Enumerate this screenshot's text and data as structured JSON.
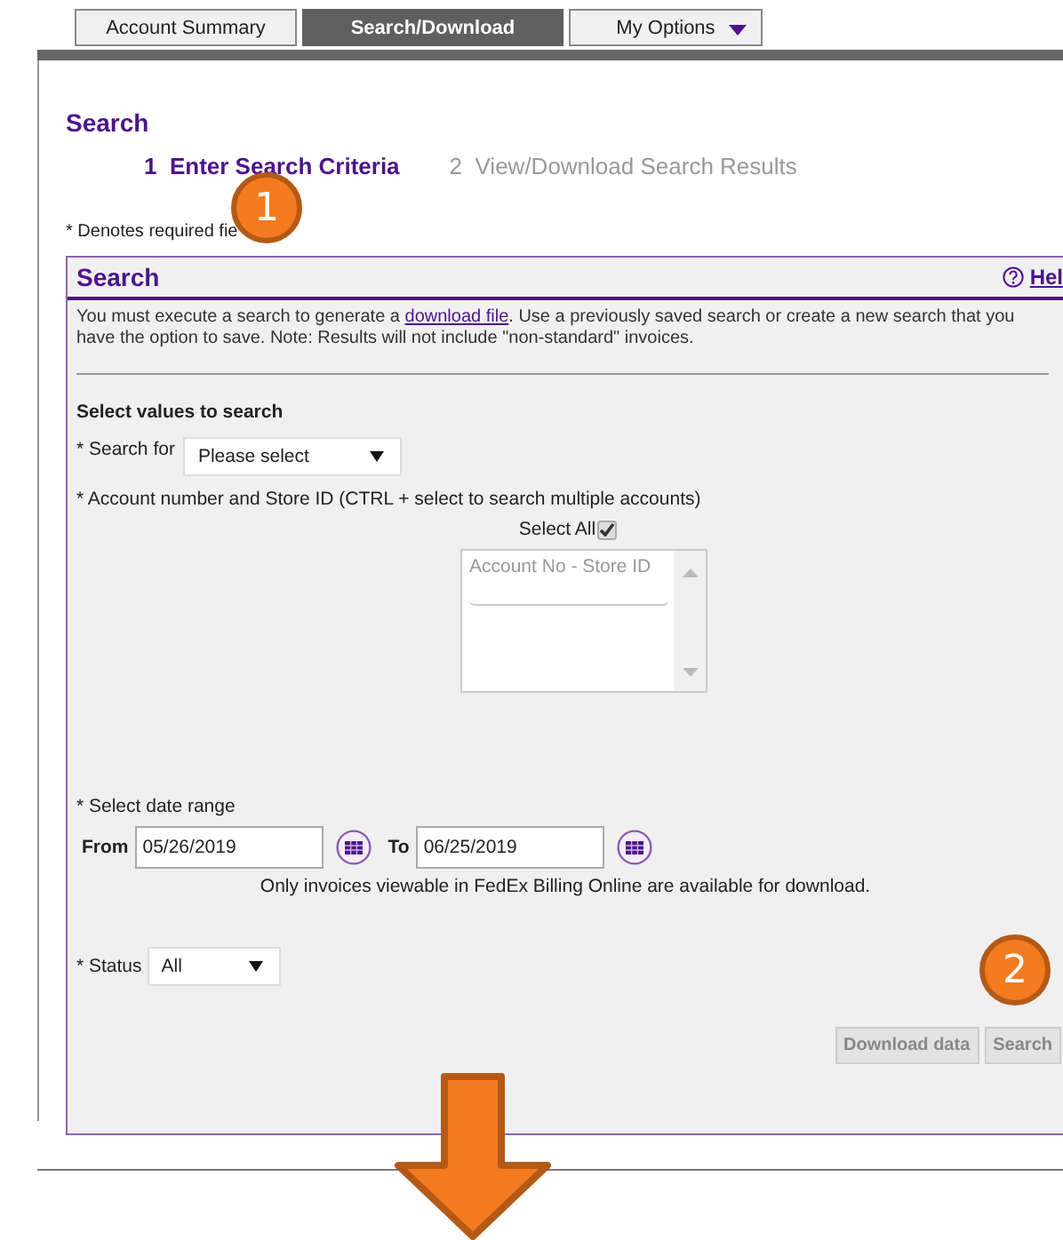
{
  "tabs": [
    {
      "label": "Account Summary",
      "selected": false,
      "dropdown": false
    },
    {
      "label": "Search/Download",
      "selected": true,
      "dropdown": false
    },
    {
      "label": "My Options",
      "selected": false,
      "dropdown": true
    }
  ],
  "page_title": "Search",
  "steps": [
    {
      "number": "1",
      "label": "Enter Search Criteria",
      "selected": true
    },
    {
      "number": "2",
      "label": "View/Download Search Results",
      "selected": false
    }
  ],
  "required_note": "* Denotes required fie",
  "panel": {
    "title": "Search",
    "help": "Hel",
    "intro": {
      "before": "You must execute a search to generate a ",
      "link": "download file",
      "after": ". Use a previously saved search or create a new search that you have the option to save. Note: Results will not include \"non-standard\" invoices."
    },
    "section_title": "Select values to search",
    "search_for": {
      "label": "* Search for",
      "value": "Please select"
    },
    "account_label": "* Account number and Store ID (CTRL + select to search multiple accounts)",
    "select_all": {
      "label": "Select All",
      "checked": true
    },
    "account_list": {
      "header": "Account No - Store ID"
    },
    "date_label": "* Select date range",
    "from": {
      "label": "From",
      "value": "05/26/2019"
    },
    "to": {
      "label": "To",
      "value": "06/25/2019"
    },
    "date_note": "Only invoices viewable in FedEx Billing Online are available for download.",
    "status": {
      "label": "* Status",
      "value": "All"
    },
    "buttons": [
      {
        "label": "Download data",
        "disabled": true
      },
      {
        "label": "Search",
        "disabled": true
      }
    ]
  },
  "callouts": [
    "1",
    "2"
  ]
}
